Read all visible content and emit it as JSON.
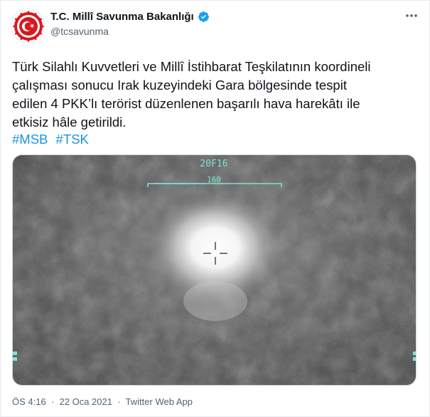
{
  "account": {
    "name": "T.C. Millî Savunma Bakanlığı",
    "handle": "@tcsavunma"
  },
  "tweet": {
    "lines": [
      "Türk Silahlı Kuvvetleri ve Millî İstihbarat Teşkilatının koordineli",
      "çalışması sonucu Irak kuzeyindeki Gara bölgesinde tespit",
      "edilen 4 PKK’lı terörist düzenlenen başarılı hava harekâtı ile",
      "etkisiz hâle getirildi."
    ],
    "hashtags": [
      "#MSB",
      "#TSK"
    ]
  },
  "media": {
    "overlay_code": "20F16",
    "overlay_heading": "160"
  },
  "meta": {
    "time": "ÖS 4:16",
    "separator": "·",
    "date": "22 Oca 2021",
    "source": "Twitter Web App"
  },
  "colors": {
    "link": "#1b95e0",
    "verified": "#1d9bf0",
    "hud": "#7fe3d8",
    "logo_red": "#d71920"
  },
  "icons": {
    "verified": "verified-badge-icon",
    "more": "more-icon",
    "crosshair": "crosshair-icon"
  }
}
